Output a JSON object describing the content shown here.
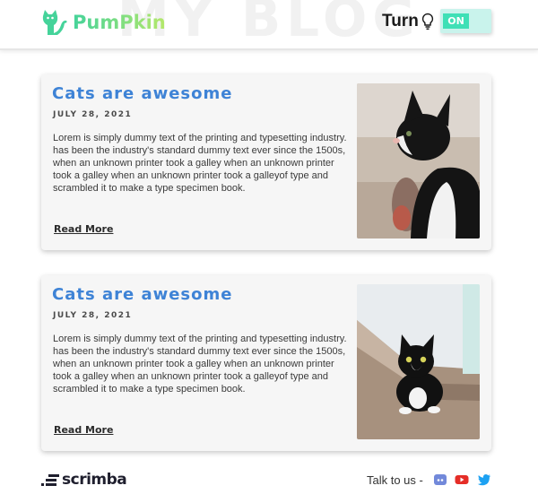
{
  "header": {
    "background_title": "MY BLOG",
    "logo_text": "PumPkin",
    "logo_icon": "cat-icon",
    "turn_label": "Turn",
    "bulb_icon": "lightbulb-icon",
    "toggle_label": "ON"
  },
  "posts": [
    {
      "title": "Cats are awesome",
      "date": "JULY 28, 2021",
      "body": "Lorem is simply dummy text of the printing and typesetting industry. has been the industry's standard dummy text ever since the 1500s, when an unknown printer took a galley when an unknown printer took a galley when an unknown printer took a galleyof type and scrambled it to make a type specimen book.",
      "read_more": "Read More",
      "image": "black-and-white-cat-photo"
    },
    {
      "title": "Cats are awesome",
      "date": "JULY 28, 2021",
      "body": "Lorem is simply dummy text of the printing and typesetting industry. has been the industry's standard dummy text ever since the 1500s, when an unknown printer took a galley when an unknown printer took a galley when an unknown printer took a galleyof type and scrambled it to make a type specimen book.",
      "read_more": "Read More",
      "image": "tuxedo-kitten-on-stairs-photo"
    }
  ],
  "footer": {
    "brand": "scrimba",
    "talk_label": "Talk to us -",
    "social_icons": [
      "discord-icon",
      "youtube-icon",
      "twitter-icon"
    ]
  },
  "colors": {
    "accent_title": "#3e83d6",
    "logo_gradient_start": "#45d39a",
    "logo_gradient_end": "#b5e86a",
    "toggle_on": "#3fe0b6",
    "discord": "#7289da",
    "youtube": "#e52d27",
    "twitter": "#1da1f2"
  }
}
